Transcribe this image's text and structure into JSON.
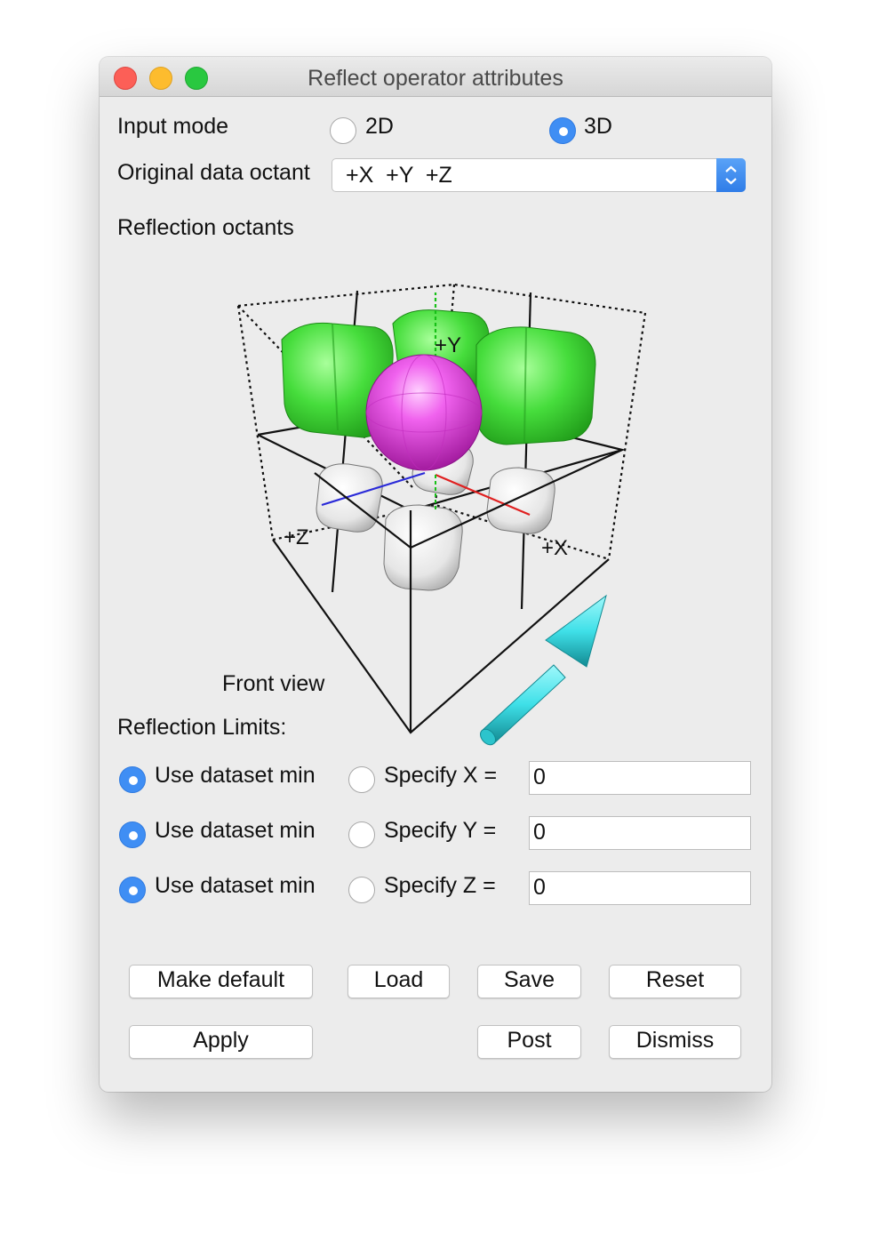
{
  "window": {
    "title": "Reflect operator attributes"
  },
  "input_mode": {
    "label": "Input mode",
    "options": [
      {
        "label": "2D",
        "selected": false
      },
      {
        "label": "3D",
        "selected": true
      }
    ]
  },
  "octant": {
    "label": "Original data octant",
    "value": "+X  +Y  +Z"
  },
  "reflection_octants": {
    "label": "Reflection octants",
    "axis_labels": {
      "x": "+X",
      "y": "+Y",
      "z": "+Z"
    },
    "view_label": "Front view"
  },
  "limits": {
    "label": "Reflection Limits:",
    "rows": [
      {
        "dataset_label": "Use dataset min",
        "dataset_selected": true,
        "specify_label": "Specify X =",
        "value": "0"
      },
      {
        "dataset_label": "Use dataset min",
        "dataset_selected": true,
        "specify_label": "Specify Y =",
        "value": "0"
      },
      {
        "dataset_label": "Use dataset min",
        "dataset_selected": true,
        "specify_label": "Specify Z =",
        "value": "0"
      }
    ]
  },
  "buttons": {
    "make_default": "Make default",
    "load": "Load",
    "save": "Save",
    "reset": "Reset",
    "apply": "Apply",
    "post": "Post",
    "dismiss": "Dismiss"
  },
  "colors": {
    "accent": "#3f8ef4",
    "green_cube": "#4be044",
    "sphere": "#e030e0",
    "arrow": "#3fe0e8"
  }
}
